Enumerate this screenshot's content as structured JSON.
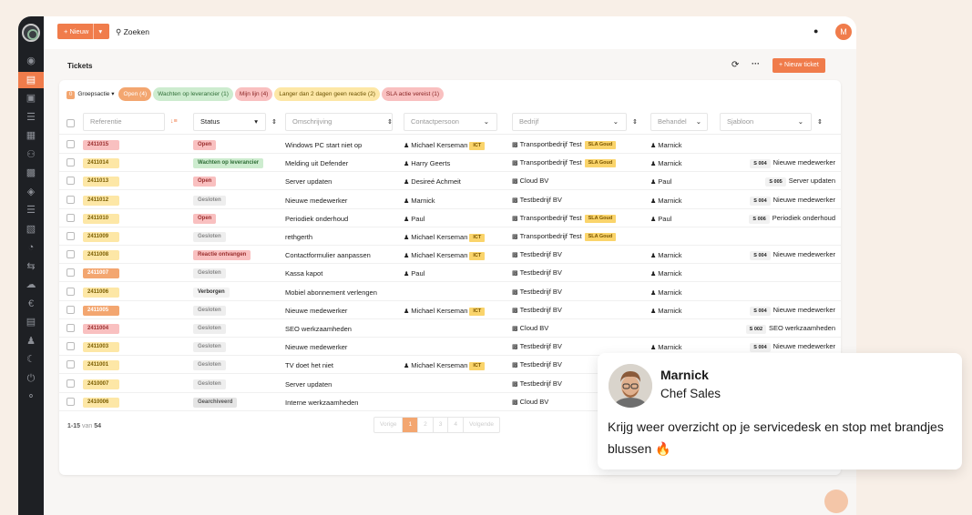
{
  "topbar": {
    "new_label": "+ Nieuw",
    "new_caret": "▾",
    "search_label": "Zoeken",
    "avatar_letter": "M"
  },
  "header": {
    "title": "Tickets",
    "refresh_icon": "⟳",
    "more_icon": "···",
    "new_ticket_label": "+ Nieuw ticket"
  },
  "filters": {
    "group_count": "0",
    "group_label": "Groepsactie ▾",
    "chips": [
      {
        "label": "Open (4)",
        "bg": "#f3a670",
        "color": "#ffffff"
      },
      {
        "label": "Wachten op leverancier (1)",
        "bg": "#cdeccf",
        "color": "#2f6e37"
      },
      {
        "label": "Mijn lijn (4)",
        "bg": "#f9c0c0",
        "color": "#8a2424"
      },
      {
        "label": "Langer dan 2 dagen geen reactie (2)",
        "bg": "#fde7a6",
        "color": "#6b5200"
      },
      {
        "label": "SLA actie vereist (1)",
        "bg": "#f9c0c0",
        "color": "#8a2424"
      }
    ]
  },
  "columns": {
    "reference": "Referentie",
    "status": "Status",
    "description": "Omschrijving",
    "contact": "Contactpersoon",
    "company": "Bedrijf",
    "handler": "Behandel",
    "template": "Sjabloon"
  },
  "rows": [
    {
      "ref": "2411015",
      "ref_color": "pink",
      "status": "Open",
      "status_kind": "open",
      "desc": "Windows PC start niet op",
      "contact": "Michael Kerseman",
      "ict": "ICT",
      "company": "Transportbedrijf Test",
      "sla": "SLA Goud",
      "handler": "Marnick",
      "tpl_code": "",
      "tpl_name": ""
    },
    {
      "ref": "2411014",
      "ref_color": "yellow",
      "status": "Wachten op leverancier",
      "status_kind": "wait",
      "desc": "Melding uit Defender",
      "contact": "Harry Geerts",
      "ict": "",
      "company": "Transportbedrijf Test",
      "sla": "SLA Goud",
      "handler": "Marnick",
      "tpl_code": "S 004",
      "tpl_name": "Nieuwe medewerker"
    },
    {
      "ref": "2411013",
      "ref_color": "yellow",
      "status": "Open",
      "status_kind": "open",
      "desc": "Server updaten",
      "contact": "Desireé Achmeit",
      "ict": "",
      "company": "Cloud BV",
      "sla": "",
      "handler": "Paul",
      "tpl_code": "S 005",
      "tpl_name": "Server updaten"
    },
    {
      "ref": "2411012",
      "ref_color": "yellow",
      "status": "Gesloten",
      "status_kind": "closed",
      "desc": "Nieuwe medewerker",
      "contact": "Marnick",
      "ict": "",
      "company": "Testbedrijf BV",
      "sla": "",
      "handler": "Marnick",
      "tpl_code": "S 004",
      "tpl_name": "Nieuwe medewerker"
    },
    {
      "ref": "2411010",
      "ref_color": "yellow",
      "status": "Open",
      "status_kind": "open",
      "desc": "Periodiek onderhoud",
      "contact": "Paul",
      "ict": "",
      "company": "Transportbedrijf Test",
      "sla": "SLA Goud",
      "handler": "Paul",
      "tpl_code": "S 006",
      "tpl_name": "Periodiek onderhoud"
    },
    {
      "ref": "2411009",
      "ref_color": "yellow",
      "status": "Gesloten",
      "status_kind": "closed",
      "desc": "rethgerth",
      "contact": "Michael Kerseman",
      "ict": "ICT",
      "company": "Transportbedrijf Test",
      "sla": "SLA Goud",
      "handler": "",
      "tpl_code": "",
      "tpl_name": ""
    },
    {
      "ref": "2411008",
      "ref_color": "yellow",
      "status": "Reactie ontvangen",
      "status_kind": "reply",
      "desc": "Contactformulier aanpassen",
      "contact": "Michael Kerseman",
      "ict": "ICT",
      "company": "Testbedrijf BV",
      "sla": "",
      "handler": "Marnick",
      "tpl_code": "S 004",
      "tpl_name": "Nieuwe medewerker"
    },
    {
      "ref": "2411007",
      "ref_color": "orange",
      "status": "Gesloten",
      "status_kind": "closed",
      "desc": "Kassa kapot",
      "contact": "Paul",
      "ict": "",
      "company": "Testbedrijf BV",
      "sla": "",
      "handler": "Marnick",
      "tpl_code": "",
      "tpl_name": ""
    },
    {
      "ref": "2411006",
      "ref_color": "yellow",
      "status": "Verborgen",
      "status_kind": "hidden",
      "desc": "Mobiel abonnement verlengen",
      "contact": "",
      "ict": "",
      "company": "Testbedrijf BV",
      "sla": "",
      "handler": "Marnick",
      "tpl_code": "",
      "tpl_name": ""
    },
    {
      "ref": "2411005",
      "ref_color": "orange",
      "status": "Gesloten",
      "status_kind": "closed",
      "desc": "Nieuwe medewerker",
      "contact": "Michael Kerseman",
      "ict": "ICT",
      "company": "Testbedrijf BV",
      "sla": "",
      "handler": "Marnick",
      "tpl_code": "S 004",
      "tpl_name": "Nieuwe medewerker"
    },
    {
      "ref": "2411004",
      "ref_color": "pink",
      "status": "Gesloten",
      "status_kind": "closed",
      "desc": "SEO werkzaamheden",
      "contact": "",
      "ict": "",
      "company": "Cloud BV",
      "sla": "",
      "handler": "",
      "tpl_code": "S 002",
      "tpl_name": "SEO werkzaamheden"
    },
    {
      "ref": "2411003",
      "ref_color": "yellow",
      "status": "Gesloten",
      "status_kind": "closed",
      "desc": "Nieuwe medewerker",
      "contact": "",
      "ict": "",
      "company": "Testbedrijf BV",
      "sla": "",
      "handler": "Marnick",
      "tpl_code": "S 004",
      "tpl_name": "Nieuwe medewerker"
    },
    {
      "ref": "2411001",
      "ref_color": "yellow",
      "status": "Gesloten",
      "status_kind": "closed",
      "desc": "TV doet het niet",
      "contact": "Michael Kerseman",
      "ict": "ICT",
      "company": "Testbedrijf BV",
      "sla": "",
      "handler": "",
      "tpl_code": "",
      "tpl_name": ""
    },
    {
      "ref": "2410007",
      "ref_color": "yellow",
      "status": "Gesloten",
      "status_kind": "closed",
      "desc": "Server updaten",
      "contact": "",
      "ict": "",
      "company": "Testbedrijf BV",
      "sla": "",
      "handler": "",
      "tpl_code": "",
      "tpl_name": ""
    },
    {
      "ref": "2410006",
      "ref_color": "yellow",
      "status": "Gearchiveerd",
      "status_kind": "archived",
      "desc": "Interne werkzaamheden",
      "contact": "",
      "ict": "",
      "company": "Cloud BV",
      "sla": "",
      "handler": "",
      "tpl_code": "",
      "tpl_name": ""
    }
  ],
  "pagination": {
    "range": "1-15",
    "of_label": "van",
    "total": "54",
    "prev": "Vorige",
    "pages": [
      "1",
      "2",
      "3",
      "4"
    ],
    "current": "1",
    "next": "Volgende"
  },
  "testimonial": {
    "name": "Marnick",
    "role": "Chef Sales",
    "message": "Krijg weer overzicht op je servicedesk en stop met brandjes blussen 🔥"
  },
  "colors": {
    "accent": "#f07c4b",
    "sidebar_bg": "#1e2024",
    "page_bg": "#f8efe7",
    "ref_pink": "#f9c0c0",
    "ref_yellow": "#fde7a6",
    "ref_orange": "#f3a670"
  },
  "sidebar_icons": [
    "globe-icon",
    "chat-icon",
    "briefcase-icon",
    "list-icon",
    "calendar-icon",
    "users-icon",
    "building-icon",
    "network-icon",
    "list-alt-icon",
    "document-icon",
    "clock-icon",
    "repeat-icon",
    "cloud-icon",
    "euro-icon",
    "chart-icon",
    "user-icon",
    "moon-icon",
    "power-icon",
    "bulb-icon"
  ]
}
